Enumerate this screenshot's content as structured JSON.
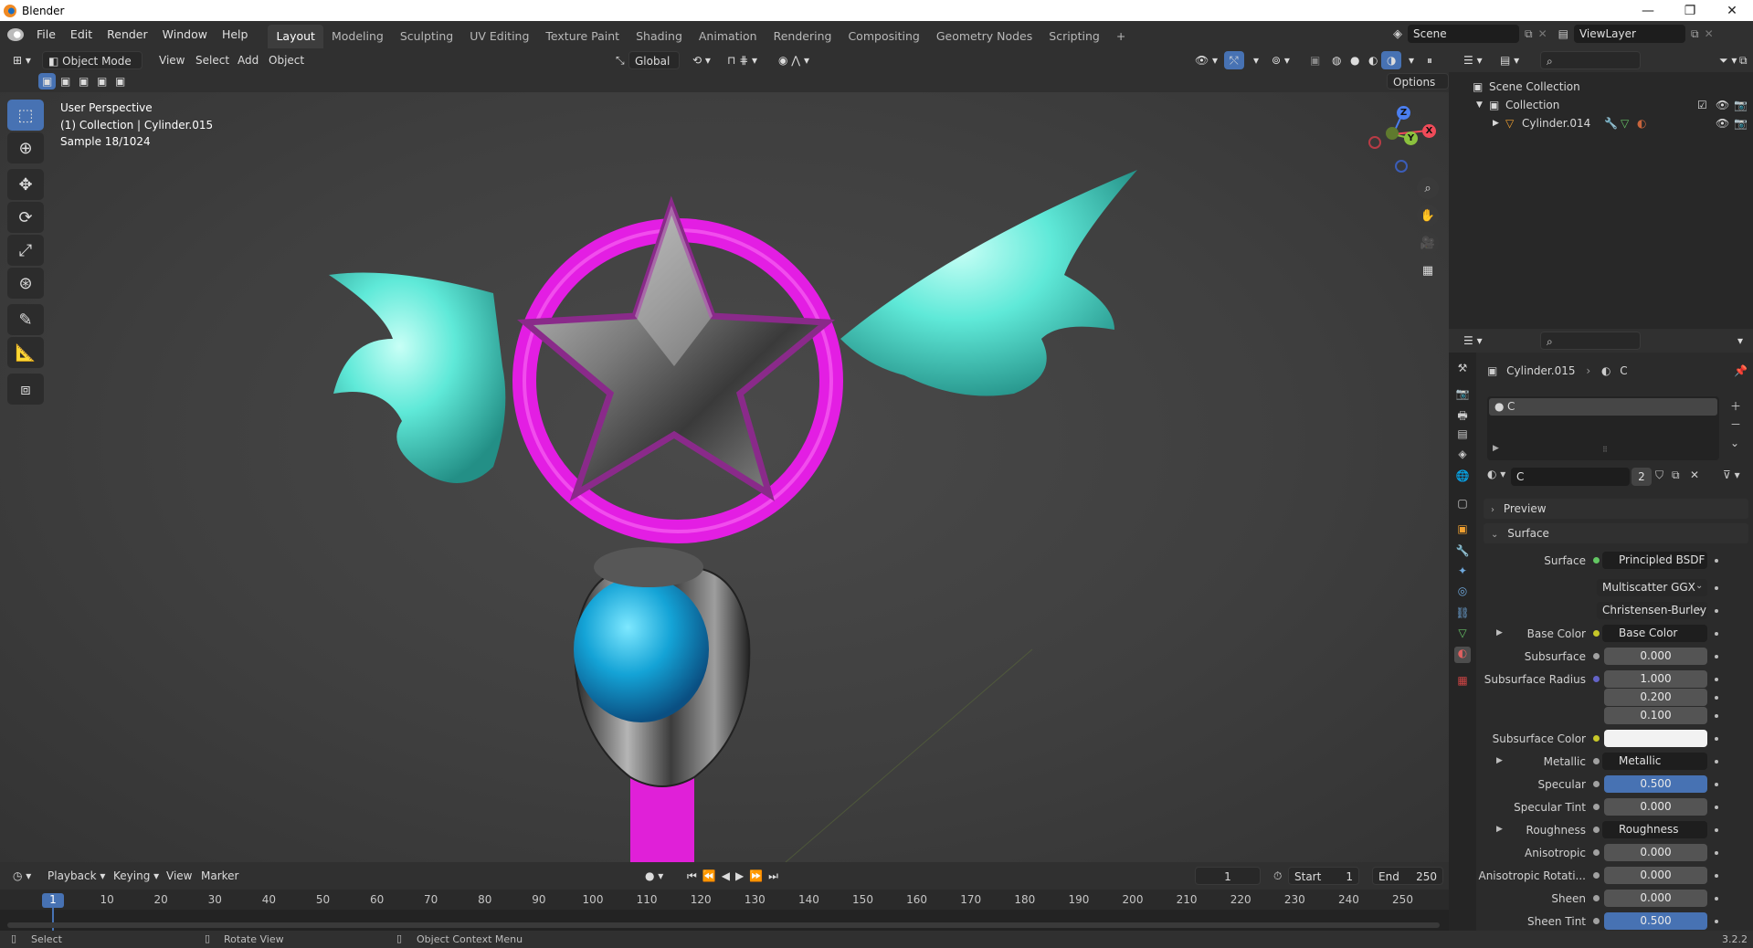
{
  "titlebar": {
    "title": "Blender",
    "minimize": "—",
    "maximize": "❐",
    "close": "✕"
  },
  "menu": [
    "File",
    "Edit",
    "Render",
    "Window",
    "Help"
  ],
  "workspaces": [
    "Layout",
    "Modeling",
    "Sculpting",
    "UV Editing",
    "Texture Paint",
    "Shading",
    "Animation",
    "Rendering",
    "Compositing",
    "Geometry Nodes",
    "Scripting",
    "+"
  ],
  "scene": {
    "label": "Scene",
    "viewlayer": "ViewLayer"
  },
  "viewport_header": {
    "mode": "Object Mode",
    "view": "View",
    "select": "Select",
    "add": "Add",
    "object": "Object",
    "orientation": "Global",
    "options": "Options"
  },
  "viewport_info": {
    "line1": "User Perspective",
    "line2": "(1) Collection | Cylinder.015",
    "line3": "Sample 18/1024"
  },
  "gizmo": {
    "z": "Z",
    "y": "Y",
    "x": "X"
  },
  "timeline": {
    "playback": "Playback",
    "keying": "Keying",
    "view": "View",
    "marker": "Marker",
    "current_frame": "1",
    "start_label": "Start",
    "start": "1",
    "end_label": "End",
    "end": "250",
    "ticks": [
      "1",
      "10",
      "20",
      "30",
      "40",
      "50",
      "60",
      "70",
      "80",
      "90",
      "100",
      "110",
      "120",
      "130",
      "140",
      "150",
      "160",
      "170",
      "180",
      "190",
      "200",
      "210",
      "220",
      "230",
      "240",
      "250"
    ]
  },
  "statusbar": {
    "select": "Select",
    "rotate": "Rotate View",
    "context": "Object Context Menu",
    "version": "3.2.2"
  },
  "outliner": {
    "scene_collection": "Scene Collection",
    "collection": "Collection",
    "object": "Cylinder.014"
  },
  "properties": {
    "breadcrumb_object": "Cylinder.015",
    "breadcrumb_material": "C",
    "slot_name": "C",
    "material_name": "C",
    "users": "2",
    "preview": "Preview",
    "surface_section": "Surface",
    "rows": [
      {
        "label": "Surface",
        "kind": "link",
        "value": "Principled BSDF",
        "sock": "#63c763"
      },
      {
        "label": "",
        "kind": "dropdown",
        "value": "Multiscatter GGX"
      },
      {
        "label": "",
        "kind": "dropdown",
        "value": "Christensen-Burley"
      },
      {
        "label": "Base Color",
        "kind": "link",
        "value": "Base Color",
        "sock": "#c7c729",
        "expand": true
      },
      {
        "label": "Subsurface",
        "kind": "num",
        "value": "0.000",
        "sock": "#a1a1a1"
      },
      {
        "label": "Subsurface Radius",
        "kind": "num",
        "value": "1.000",
        "sock": "#6363c7"
      },
      {
        "label": "",
        "kind": "num",
        "value": "0.200"
      },
      {
        "label": "",
        "kind": "num",
        "value": "0.100"
      },
      {
        "label": "Subsurface Color",
        "kind": "color",
        "value": "",
        "sock": "#c7c729"
      },
      {
        "label": "Metallic",
        "kind": "link",
        "value": "Metallic",
        "sock": "#a1a1a1",
        "expand": true
      },
      {
        "label": "Specular",
        "kind": "slider",
        "value": "0.500",
        "sock": "#a1a1a1",
        "fill": 1.0
      },
      {
        "label": "Specular Tint",
        "kind": "num",
        "value": "0.000",
        "sock": "#a1a1a1"
      },
      {
        "label": "Roughness",
        "kind": "link",
        "value": "Roughness",
        "sock": "#a1a1a1",
        "expand": true
      },
      {
        "label": "Anisotropic",
        "kind": "num",
        "value": "0.000",
        "sock": "#a1a1a1"
      },
      {
        "label": "Anisotropic Rotati...",
        "kind": "num",
        "value": "0.000",
        "sock": "#a1a1a1"
      },
      {
        "label": "Sheen",
        "kind": "num",
        "value": "0.000",
        "sock": "#a1a1a1"
      },
      {
        "label": "Sheen Tint",
        "kind": "slider",
        "value": "0.500",
        "sock": "#a1a1a1",
        "fill": 1.0
      }
    ]
  },
  "colors": {
    "accent": "#4772b3",
    "magenta": "#e31ee3",
    "cyan": "#5ee8d8"
  }
}
